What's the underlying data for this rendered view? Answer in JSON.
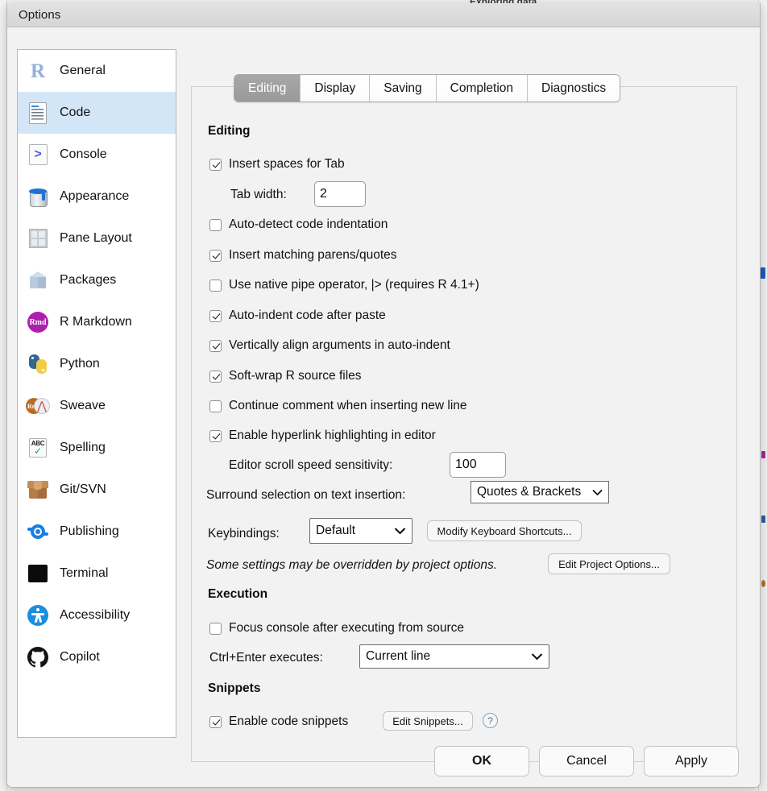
{
  "window": {
    "title": "Options"
  },
  "backdrop": {
    "ghost_text": "Exploring data"
  },
  "sidebar": {
    "items": [
      {
        "label": "General",
        "icon": "r-logo-icon",
        "selected": false
      },
      {
        "label": "Code",
        "icon": "code-document-icon",
        "selected": true
      },
      {
        "label": "Console",
        "icon": "console-prompt-icon",
        "selected": false
      },
      {
        "label": "Appearance",
        "icon": "paint-can-icon",
        "selected": false
      },
      {
        "label": "Pane Layout",
        "icon": "pane-grid-icon",
        "selected": false
      },
      {
        "label": "Packages",
        "icon": "package-box-icon",
        "selected": false
      },
      {
        "label": "R Markdown",
        "icon": "rmd-badge-icon",
        "selected": false
      },
      {
        "label": "Python",
        "icon": "python-logo-icon",
        "selected": false
      },
      {
        "label": "Sweave",
        "icon": "sweave-rnw-pdf-icon",
        "selected": false
      },
      {
        "label": "Spelling",
        "icon": "spellcheck-abc-icon",
        "selected": false
      },
      {
        "label": "Git/SVN",
        "icon": "git-box-icon",
        "selected": false
      },
      {
        "label": "Publishing",
        "icon": "publishing-ring-icon",
        "selected": false
      },
      {
        "label": "Terminal",
        "icon": "terminal-square-icon",
        "selected": false
      },
      {
        "label": "Accessibility",
        "icon": "accessibility-icon",
        "selected": false
      },
      {
        "label": "Copilot",
        "icon": "github-copilot-icon",
        "selected": false
      }
    ],
    "selected_index": 1,
    "selected_color": "#d3e6f7"
  },
  "tabs": [
    {
      "label": "Editing",
      "active": true
    },
    {
      "label": "Display",
      "active": false
    },
    {
      "label": "Saving",
      "active": false
    },
    {
      "label": "Completion",
      "active": false
    },
    {
      "label": "Diagnostics",
      "active": false
    }
  ],
  "editing": {
    "heading": "Editing",
    "checkboxes": [
      {
        "label": "Insert spaces for Tab",
        "checked": true
      },
      {
        "label": "Auto-detect code indentation",
        "checked": false
      },
      {
        "label": "Insert matching parens/quotes",
        "checked": true
      },
      {
        "label": "Use native pipe operator, |> (requires R 4.1+)",
        "checked": false
      },
      {
        "label": "Auto-indent code after paste",
        "checked": true
      },
      {
        "label": "Vertically align arguments in auto-indent",
        "checked": true
      },
      {
        "label": "Soft-wrap R source files",
        "checked": true
      },
      {
        "label": "Continue comment when inserting new line",
        "checked": false
      },
      {
        "label": "Enable hyperlink highlighting in editor",
        "checked": true
      }
    ],
    "tab_width": {
      "label": "Tab width:",
      "value": "2"
    },
    "scroll_speed": {
      "label": "Editor scroll speed sensitivity:",
      "value": "100"
    },
    "surround_selection": {
      "label": "Surround selection on text insertion:",
      "value": "Quotes & Brackets"
    },
    "keybindings": {
      "label": "Keybindings:",
      "value": "Default"
    },
    "modify_shortcuts_button": "Modify Keyboard Shortcuts...",
    "override_note": "Some settings may be overridden by project options.",
    "edit_project_options_button": "Edit Project Options..."
  },
  "execution": {
    "heading": "Execution",
    "focus_console": {
      "label": "Focus console after executing from source",
      "checked": false
    },
    "ctrl_enter": {
      "label": "Ctrl+Enter executes:",
      "value": "Current line"
    }
  },
  "snippets": {
    "heading": "Snippets",
    "enable": {
      "label": "Enable code snippets",
      "checked": true
    },
    "edit_snippets_button": "Edit Snippets...",
    "help_glyph": "?"
  },
  "footer": {
    "ok": "OK",
    "cancel": "Cancel",
    "apply": "Apply"
  }
}
